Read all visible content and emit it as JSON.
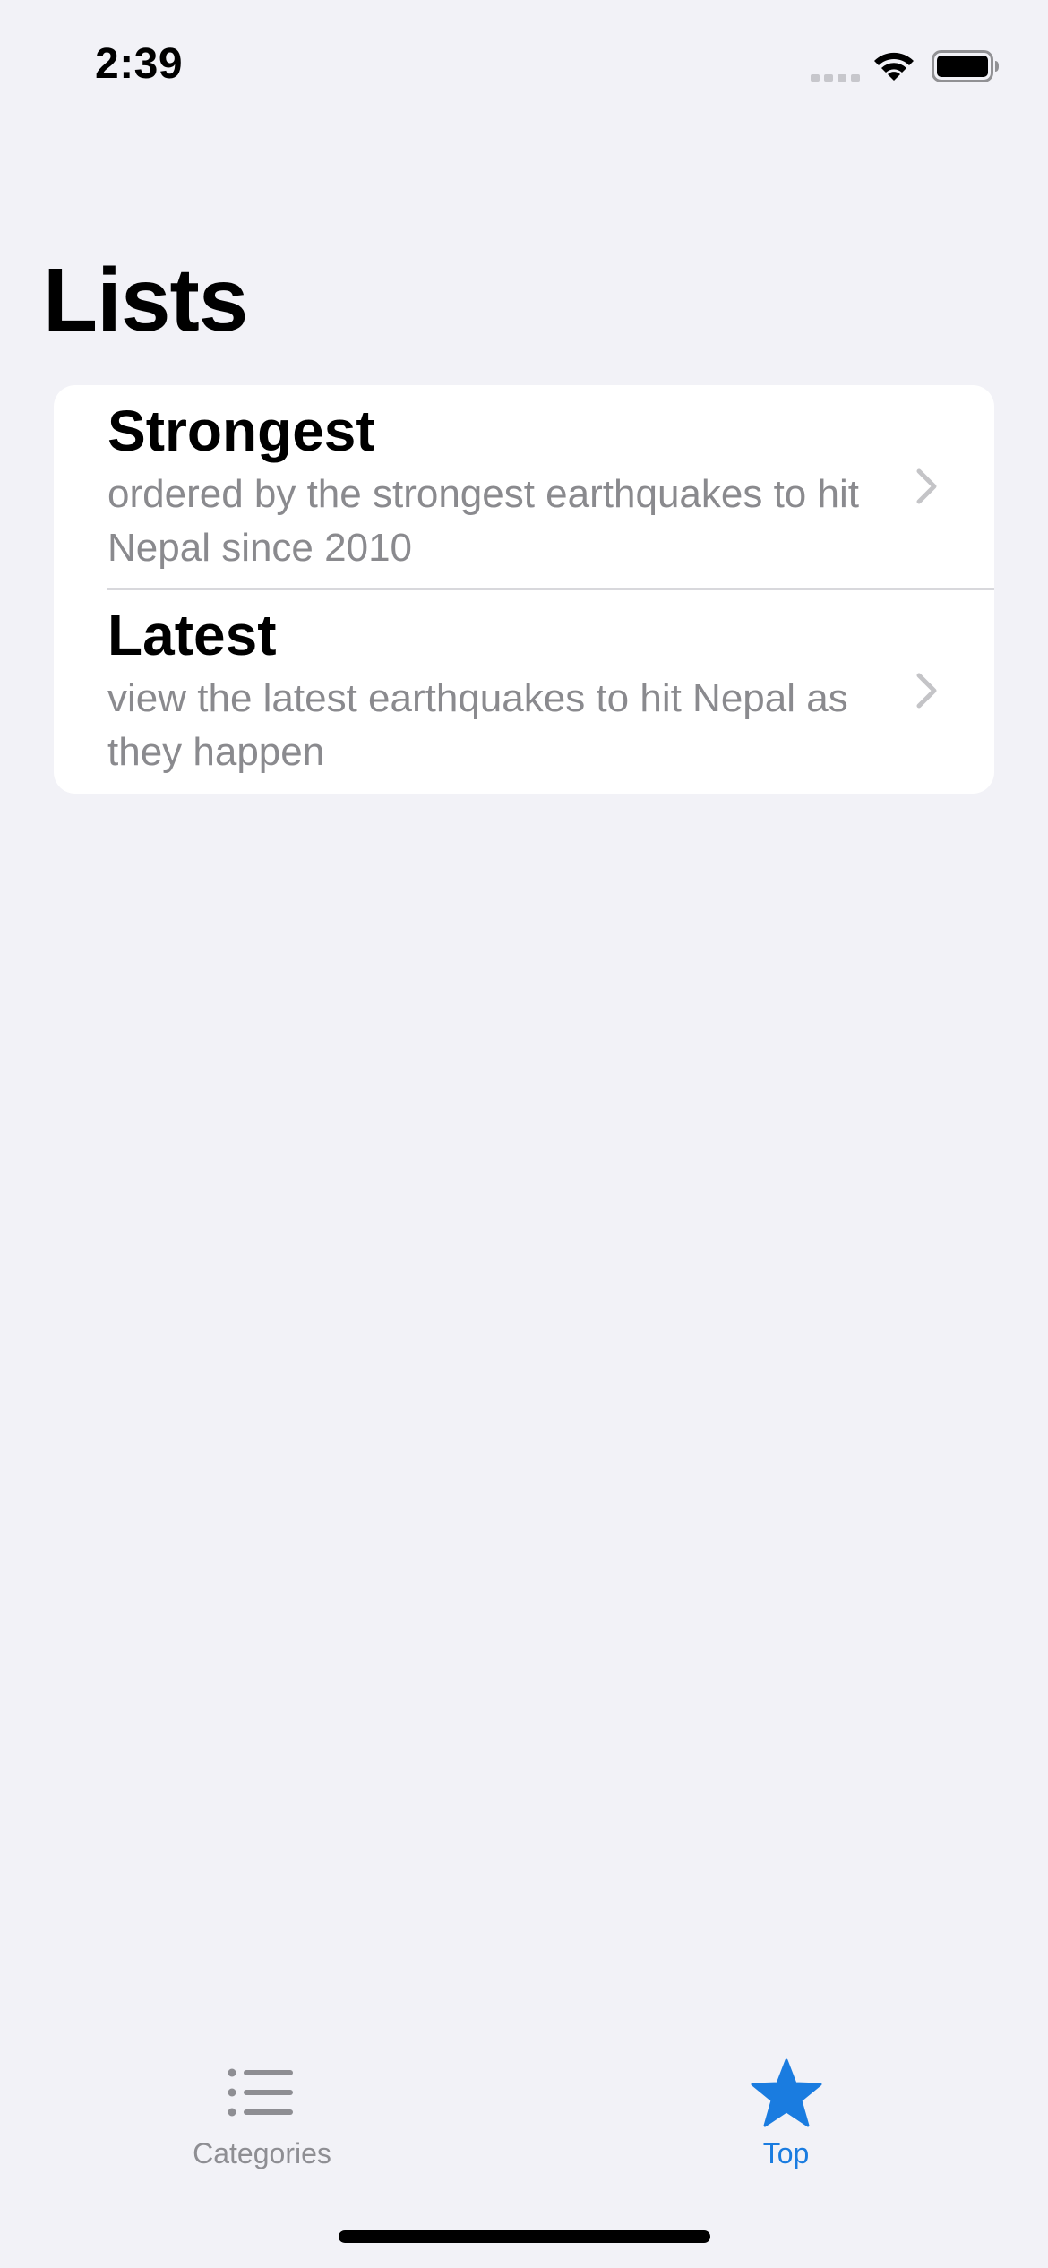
{
  "status_bar": {
    "time": "2:39"
  },
  "page": {
    "title": "Lists"
  },
  "list": {
    "items": [
      {
        "title": "Strongest",
        "subtitle": "ordered by the strongest earthquakes to hit Nepal since 2010"
      },
      {
        "title": "Latest",
        "subtitle": "view the latest earthquakes to hit Nepal as they happen"
      }
    ]
  },
  "tab_bar": {
    "tabs": [
      {
        "label": "Categories",
        "icon": "list-bullet-icon",
        "selected": false
      },
      {
        "label": "Top",
        "icon": "star-icon",
        "selected": true
      }
    ]
  },
  "colors": {
    "background": "#f2f2f7",
    "card": "#ffffff",
    "secondary_text": "#8a8a8e",
    "accent": "#1a7ce0",
    "inactive_tab": "#8e8e93"
  }
}
